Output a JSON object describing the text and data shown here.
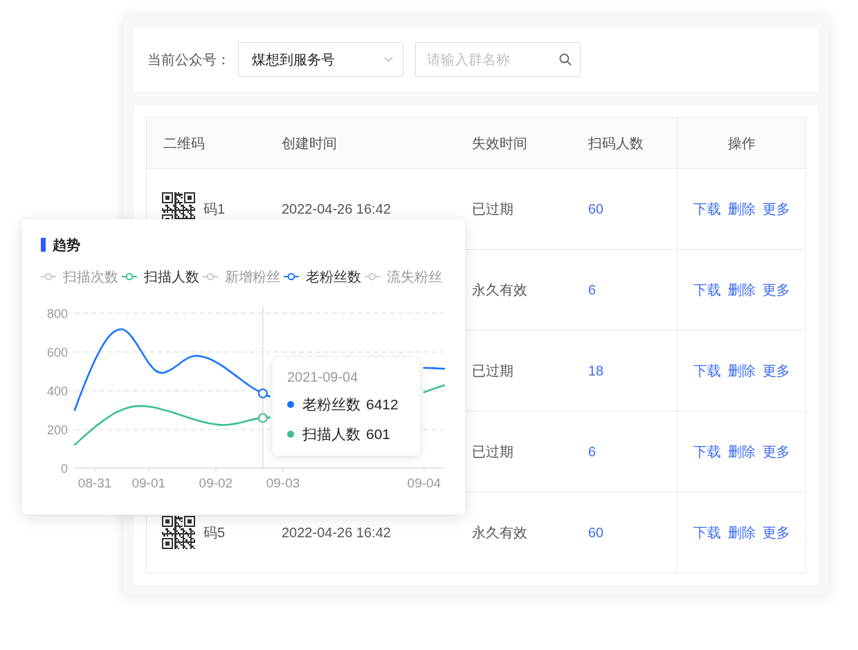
{
  "filter_bar": {
    "account_label": "当前公众号：",
    "account_select": {
      "value": "煤想到服务号"
    },
    "group_search": {
      "placeholder": "请输入群名称"
    }
  },
  "table": {
    "columns": [
      "二维码",
      "创建时间",
      "失效时间",
      "扫码人数",
      "操作"
    ],
    "rows": [
      {
        "code": "码1",
        "created": "2022-04-26 16:42",
        "expires": "已过期",
        "scans": "60",
        "actions": [
          "下载",
          "删除",
          "更多"
        ]
      },
      {
        "expires": "永久有效",
        "scans": "6",
        "actions": [
          "下载",
          "删除",
          "更多"
        ]
      },
      {
        "expires": "已过期",
        "scans": "18",
        "actions": [
          "下载",
          "删除",
          "更多"
        ]
      },
      {
        "expires": "已过期",
        "scans": "6",
        "actions": [
          "下载",
          "删除",
          "更多"
        ]
      },
      {
        "code": "码5",
        "created": "2022-04-26 16:42",
        "expires": "永久有效",
        "scans": "60",
        "actions": [
          "下载",
          "删除",
          "更多"
        ]
      }
    ]
  },
  "trend_card": {
    "title": "趋势",
    "legend": [
      {
        "label": "扫描次数",
        "selected": false
      },
      {
        "label": "扫描人数",
        "selected": true,
        "color": "#3cbf8f"
      },
      {
        "label": "新增粉丝",
        "selected": false
      },
      {
        "label": "老粉丝数",
        "selected": true,
        "color": "#1a73ff"
      },
      {
        "label": "流失粉丝",
        "selected": false
      }
    ],
    "chart_data": {
      "type": "line",
      "categories": [
        null,
        null,
        null,
        "08-31",
        null,
        null,
        null,
        null,
        null,
        null,
        null,
        "09-01",
        null,
        null,
        null,
        null,
        null,
        null,
        null,
        null,
        null,
        "09-02",
        null,
        null,
        null,
        null,
        null,
        null,
        null,
        null,
        null,
        "09-03",
        null,
        null,
        null,
        null,
        null,
        null,
        null,
        null,
        null,
        null,
        null,
        null,
        null,
        null,
        null,
        null,
        null,
        null,
        null,
        null,
        "09-04",
        null,
        null,
        null
      ],
      "series": [
        {
          "name": "老粉丝数",
          "color": "#1a73ff",
          "values": [
            300,
            393,
            479,
            557,
            624,
            676,
            708,
            718,
            697,
            653,
            598,
            544,
            505,
            492,
            503,
            524,
            550,
            571,
            580,
            576,
            565,
            548,
            527,
            502,
            477,
            451,
            426,
            404,
            386,
            370,
            null,
            null,
            null,
            null,
            null,
            null,
            null,
            null,
            null,
            null,
            null,
            null,
            null,
            null,
            null,
            null,
            null,
            null,
            null,
            null,
            null,
            null,
            518,
            517,
            515,
            514
          ]
        },
        {
          "name": "扫描人数",
          "color": "#3cbf8f",
          "values": [
            120,
            152,
            183,
            212,
            239,
            263,
            285,
            301,
            313,
            320,
            321,
            318,
            312,
            303,
            294,
            283,
            271,
            260,
            249,
            239,
            231,
            226,
            223,
            225,
            230,
            238,
            247,
            255,
            259,
            262,
            null,
            null,
            null,
            null,
            null,
            null,
            null,
            null,
            null,
            null,
            null,
            null,
            null,
            null,
            null,
            null,
            null,
            null,
            null,
            null,
            null,
            null,
            392,
            405,
            417,
            428
          ]
        }
      ],
      "ylim": [
        0,
        800
      ],
      "yticks": [
        0,
        200,
        400,
        600,
        800
      ],
      "grid": true
    },
    "tooltip": {
      "date": "2021-09-04",
      "items": [
        {
          "value": "6412"
        },
        {
          "value": "601"
        }
      ]
    }
  }
}
